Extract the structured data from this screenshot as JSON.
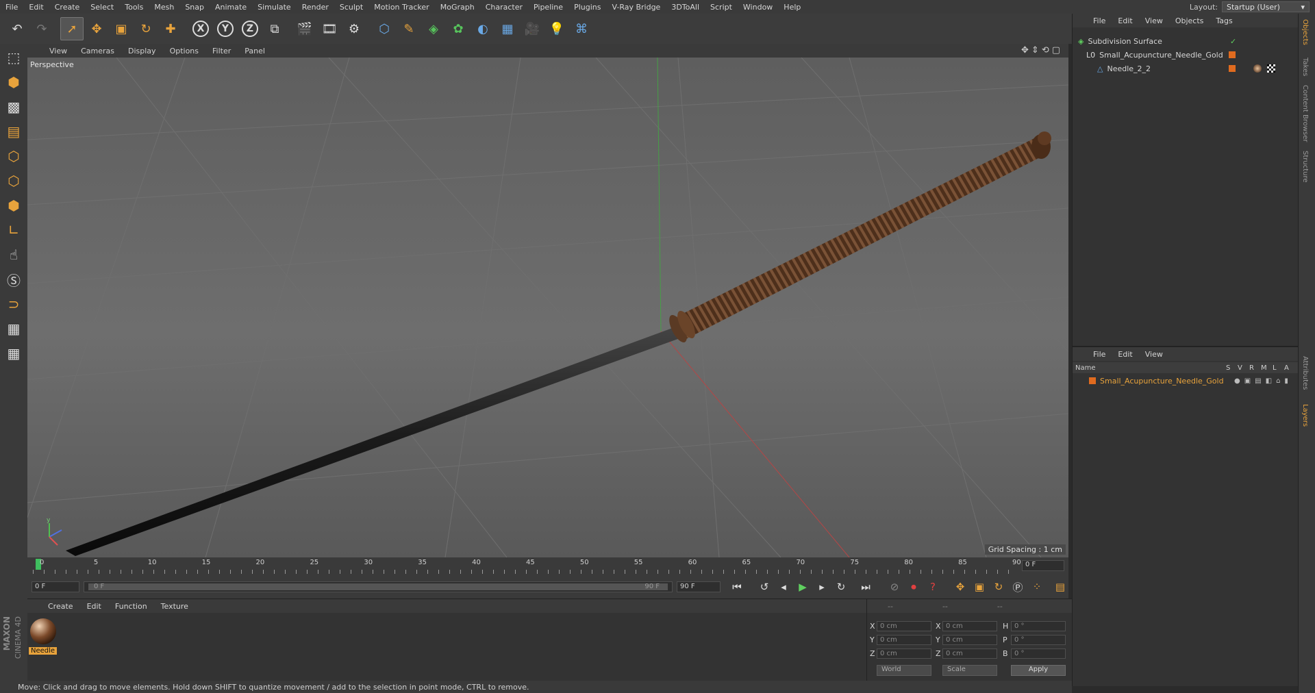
{
  "menubar": {
    "items": [
      "File",
      "Edit",
      "Create",
      "Select",
      "Tools",
      "Mesh",
      "Snap",
      "Animate",
      "Simulate",
      "Render",
      "Sculpt",
      "Motion Tracker",
      "MoGraph",
      "Character",
      "Pipeline",
      "Plugins",
      "V-Ray Bridge",
      "3DToAll",
      "Script",
      "Window",
      "Help"
    ],
    "layout_label": "Layout:",
    "layout_value": "Startup (User)"
  },
  "toolbar": {
    "icons": [
      "undo-icon",
      "redo-icon",
      "select-arrow-icon",
      "move-icon",
      "scale-icon",
      "rotate-icon",
      "add-icon",
      "x-axis-icon",
      "y-axis-icon",
      "z-axis-icon",
      "coordinate-system-icon",
      "render-view-icon",
      "render-picture-viewer-icon",
      "render-settings-icon",
      "cube-icon",
      "pen-icon",
      "subdivision-icon",
      "cloner-icon",
      "deformer-icon",
      "floor-icon",
      "camera-icon",
      "light-icon",
      "python-icon"
    ],
    "axis_x": "X",
    "axis_y": "Y",
    "axis_z": "Z"
  },
  "viewport": {
    "menu": [
      "View",
      "Cameras",
      "Display",
      "Options",
      "Filter",
      "Panel"
    ],
    "label": "Perspective",
    "grid_spacing": "Grid Spacing : 1 cm"
  },
  "timeline": {
    "ticks": [
      "0",
      "5",
      "10",
      "15",
      "20",
      "25",
      "30",
      "35",
      "40",
      "45",
      "50",
      "55",
      "60",
      "65",
      "70",
      "75",
      "80",
      "85",
      "90"
    ],
    "current_frame": "0 F",
    "start_field": "0 F",
    "range_start": "0 F",
    "range_end": "90 F",
    "end_field": "90 F"
  },
  "object_manager": {
    "menu": [
      "File",
      "Edit",
      "View",
      "Objects",
      "Tags"
    ],
    "objects": [
      {
        "name": "Subdivision Surface",
        "indent": 0
      },
      {
        "name": "Small_Acupuncture_Needle_Gold",
        "indent": 1
      },
      {
        "name": "Needle_2_2",
        "indent": 2
      }
    ]
  },
  "layer_manager": {
    "menu": [
      "File",
      "Edit",
      "View"
    ],
    "columns": [
      "Name",
      "S",
      "V",
      "R",
      "M",
      "L",
      "A"
    ],
    "layer_name": "Small_Acupuncture_Needle_Gold"
  },
  "material_manager": {
    "menu": [
      "Create",
      "Edit",
      "Function",
      "Texture"
    ],
    "material_name": "Needle"
  },
  "coordinates": {
    "header": [
      "--",
      "--",
      "--"
    ],
    "rows": [
      {
        "label1": "X",
        "val1": "0 cm",
        "label2": "X",
        "val2": "0 cm",
        "label3": "H",
        "val3": "0 °"
      },
      {
        "label1": "Y",
        "val1": "0 cm",
        "label2": "Y",
        "val2": "0 cm",
        "label3": "P",
        "val3": "0 °"
      },
      {
        "label1": "Z",
        "val1": "0 cm",
        "label2": "Z",
        "val2": "0 cm",
        "label3": "B",
        "val3": "0 °"
      }
    ],
    "mode1": "World",
    "mode2": "Scale",
    "apply": "Apply"
  },
  "right_tabs": [
    "Objects",
    "Takes",
    "Content Browser",
    "Structure",
    "Attributes",
    "Layers"
  ],
  "branding": {
    "maxon": "MAXON",
    "product": "CINEMA 4D"
  },
  "status": "Move: Click and drag to move elements. Hold down SHIFT to quantize movement / add to the selection in point mode, CTRL to remove.",
  "colors": {
    "accent": "#e8a33c",
    "selection": "#5fb35f",
    "layer_name": "#e8a33c",
    "tag_orange": "#e06b1f"
  }
}
